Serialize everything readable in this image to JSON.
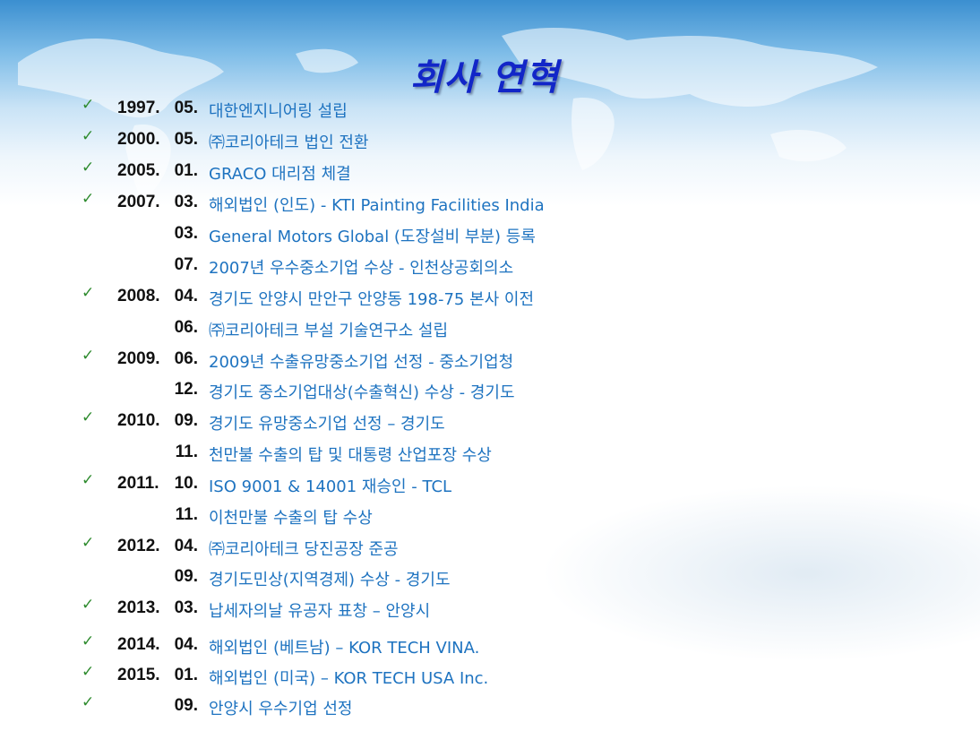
{
  "slide": {
    "title": "회사 연혁",
    "check_glyph": "✓",
    "colors": {
      "title": "#1226c8",
      "desc": "#1e73c0",
      "date": "#111111",
      "check": "#2e8b2e"
    }
  },
  "entries": [
    {
      "year": "1997.",
      "month": "05.",
      "text": "대한엔지니어링 설립",
      "check": true
    },
    {
      "year": "2000.",
      "month": "05.",
      "text": "㈜코리아테크 법인 전환",
      "check": true
    },
    {
      "year": "2005.",
      "month": "01.",
      "text": "GRACO 대리점 체결",
      "check": true
    },
    {
      "year": "2007.",
      "month": "03.",
      "text": "해외법인 (인도) - KTI Painting Facilities India",
      "check": true
    },
    {
      "year": "",
      "month": "03.",
      "text": "General Motors Global (도장설비 부분) 등록",
      "check": false
    },
    {
      "year": "",
      "month": "07.",
      "text": "2007년 우수중소기업 수상 - 인천상공회의소",
      "check": false
    },
    {
      "year": "2008.",
      "month": "04.",
      "text": "경기도 안양시 만안구 안양동 198-75 본사 이전",
      "check": true
    },
    {
      "year": "",
      "month": "06.",
      "text": "㈜코리아테크 부설 기술연구소 설립",
      "check": false
    },
    {
      "year": "2009.",
      "month": "06.",
      "text": "2009년 수출유망중소기업 선정 - 중소기업청",
      "check": true
    },
    {
      "year": "",
      "month": "12.",
      "text": "경기도 중소기업대상(수출혁신) 수상 - 경기도",
      "check": false
    },
    {
      "year": "2010.",
      "month": "09.",
      "text": "경기도 유망중소기업 선정 – 경기도",
      "check": true
    },
    {
      "year": "",
      "month": "11.",
      "text": "천만불 수출의 탑 및 대통령 산업포장 수상",
      "check": false
    },
    {
      "year": "2011.",
      "month": "10.",
      "text": "ISO 9001 & 14001 재승인 - TCL",
      "check": true
    },
    {
      "year": "",
      "month": "11.",
      "text": "이천만불 수출의 탑 수상",
      "check": false
    },
    {
      "year": "2012.",
      "month": "04.",
      "text": "㈜코리아테크 당진공장 준공",
      "check": true
    },
    {
      "year": "",
      "month": "09.",
      "text": "경기도민상(지역경제) 수상 - 경기도",
      "check": false
    },
    {
      "year": "2013.",
      "month": "03.",
      "text": "납세자의날 유공자 표창 – 안양시",
      "check": true
    },
    {
      "year": "2014.",
      "month": "04.",
      "text": "해외법인 (베트남) – KOR TECH VINA.",
      "check": true
    },
    {
      "year": "2015.",
      "month": "01.",
      "text": "해외법인 (미국) – KOR TECH USA Inc.",
      "check": true
    },
    {
      "year": "",
      "month": "09.",
      "text": "안양시 우수기업 선정",
      "check": true
    }
  ]
}
